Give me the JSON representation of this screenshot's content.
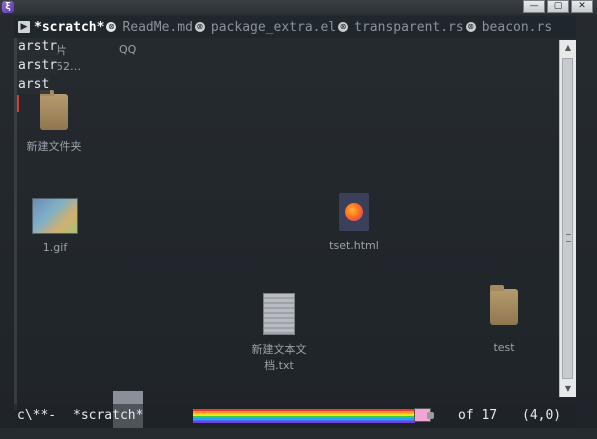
{
  "window": {
    "app_icon_glyph": "ξ",
    "buttons": {
      "minimize": "—",
      "maximize": "▢",
      "close": "✕"
    }
  },
  "tabs": {
    "left_arrow": "▶",
    "items": [
      {
        "label": "*scratch*",
        "active": true
      },
      {
        "label": "ReadMe.md",
        "active": false
      },
      {
        "label": "package_extra.el",
        "active": false
      },
      {
        "label": "transparent.rs",
        "active": false
      },
      {
        "label": "beacon.rs",
        "active": false
      }
    ],
    "close_glyph": "⊗"
  },
  "editor": {
    "lines": [
      "arstr",
      "arstr",
      "arst"
    ]
  },
  "desktop": {
    "icons": [
      {
        "label": "片",
        "id": "top-partial-1"
      },
      {
        "label": "52…",
        "id": "top-partial-2"
      },
      {
        "label": "QQ",
        "id": "qq"
      },
      {
        "label": "新建文件夹",
        "id": "new-folder"
      },
      {
        "label": "1.gif",
        "id": "gif"
      },
      {
        "label": "tset.html",
        "id": "html"
      },
      {
        "label": "新建文本文",
        "id": "txt-line1"
      },
      {
        "label": "档.txt",
        "id": "txt-line2"
      },
      {
        "label": "test",
        "id": "test-folder"
      }
    ]
  },
  "modeline": {
    "state": "c\\**-",
    "buffer": "*scratch*",
    "position": "of 17",
    "line_col": "(4,0)"
  },
  "scrollbar": {
    "up_glyph": "▲",
    "down_glyph": "▼",
    "grip": "≡"
  },
  "colors": {
    "background": "#20262c",
    "cursor": "#d43c3c",
    "active_tab": "#ffffff",
    "inactive_tab": "#8b929a"
  }
}
